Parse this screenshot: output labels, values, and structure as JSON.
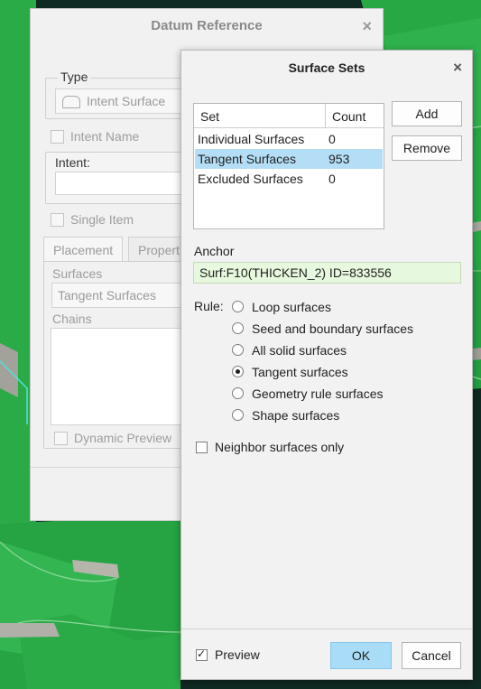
{
  "datum_reference": {
    "title": "Datum Reference",
    "close": "×",
    "type_group_label": "Type",
    "type_value": "Intent Surface",
    "intent_name_label": "Intent Name",
    "intent_label": "Intent:",
    "single_item_label": "Single Item",
    "tabs": [
      "Placement",
      "Propert"
    ],
    "surfaces_label": "Surfaces",
    "surfaces_value": "Tangent Surfaces",
    "chains_label": "Chains",
    "dynamic_preview_label": "Dynamic Preview"
  },
  "surface_sets": {
    "title": "Surface Sets",
    "close": "×",
    "table": {
      "columns": [
        "Set",
        "Count"
      ],
      "rows": [
        {
          "set": "Individual Surfaces",
          "count": "0",
          "selected": false
        },
        {
          "set": "Tangent Surfaces",
          "count": "953",
          "selected": true
        },
        {
          "set": "Excluded Surfaces",
          "count": "0",
          "selected": false
        }
      ]
    },
    "add_label": "Add",
    "remove_label": "Remove",
    "anchor_label": "Anchor",
    "anchor_value": "Surf:F10(THICKEN_2) ID=833556",
    "rule_label": "Rule:",
    "rules": [
      {
        "label": "Loop surfaces",
        "selected": false
      },
      {
        "label": "Seed and boundary surfaces",
        "selected": false
      },
      {
        "label": "All solid surfaces",
        "selected": false
      },
      {
        "label": "Tangent surfaces",
        "selected": true
      },
      {
        "label": "Geometry rule surfaces",
        "selected": false
      },
      {
        "label": "Shape surfaces",
        "selected": false
      }
    ],
    "neighbor_label": "Neighbor surfaces only",
    "neighbor_checked": false,
    "preview_label": "Preview",
    "preview_checked": true,
    "ok_label": "OK",
    "cancel_label": "Cancel"
  },
  "colors": {
    "model_green": "#27a845",
    "model_edge": "#8fd99c",
    "viewport_bg": "#0f2a22",
    "selection_blue": "#b3def5",
    "anchor_bg": "#e6f8dd",
    "ok_button": "#a9dcf7"
  }
}
